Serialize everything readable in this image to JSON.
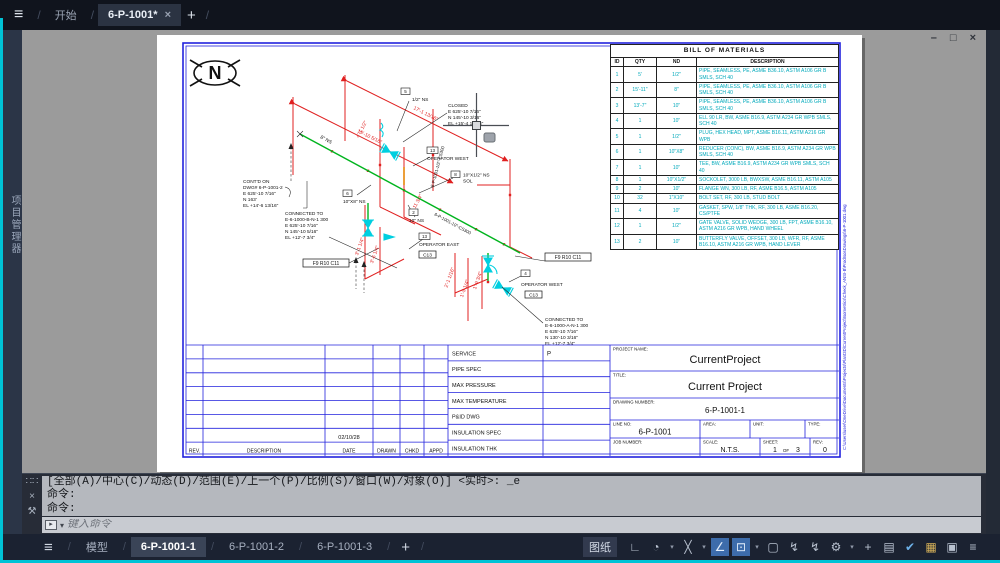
{
  "window": {
    "menu_icon": "≡",
    "slash": "/",
    "tabs": [
      {
        "label": "开始"
      },
      {
        "label": "6-P-1001*",
        "close": "×"
      }
    ],
    "new_tab": "+"
  },
  "sidebar": {
    "label": "项目管理器"
  },
  "canvas_controls": {
    "minimize": "–",
    "restore": "□",
    "close": "×"
  },
  "paper": {
    "north_letter": "N",
    "watermark_path": "C:\\Users\\user\\OneDrive\\Documents\\Projects\\Plant3D\\CurrentProject\\Isometrics\\Check_ANSI-B\\ProdIsosDrawings\\6-P-1001.dwg",
    "bom": {
      "title": "BILL OF MATERIALS",
      "headers": [
        "ID",
        "QTY",
        "ND",
        "DESCRIPTION"
      ],
      "rows": [
        {
          "id": "1",
          "qty": "5'",
          "nd": "1/2\"",
          "desc": "PIPE, SEAMLESS, PE, ASME B36.10, ASTM A106 GR B SMLS, SCH 40"
        },
        {
          "id": "2",
          "qty": "15'-11\"",
          "nd": "8\"",
          "desc": "PIPE, SEAMLESS, PE, ASME B36.10, ASTM A106 GR B SMLS, SCH 40"
        },
        {
          "id": "3",
          "qty": "13'-7\"",
          "nd": "10\"",
          "desc": "PIPE, SEAMLESS, PE, ASME B36.10, ASTM A106 GR B SMLS, SCH 40"
        },
        {
          "id": "4",
          "qty": "1",
          "nd": "10\"",
          "desc": "ELL 90 LR, BW, ASME B16.9, ASTM A234 GR WPB SMLS, SCH 40"
        },
        {
          "id": "5",
          "qty": "1",
          "nd": "1/2\"",
          "desc": "PLUG, HEX HEAD, MPT, ASME B16.11, ASTM A216 GR WPB"
        },
        {
          "id": "6",
          "qty": "1",
          "nd": "10\"X8\"",
          "desc": "REDUCER (CONC), BW, ASME B16.9, ASTM A234 GR WPB SMLS, SCH 40"
        },
        {
          "id": "7",
          "qty": "1",
          "nd": "10\"",
          "desc": "TEE, BW, ASME B16.9, ASTM A234 GR WPB SMLS, SCH 40"
        },
        {
          "id": "8",
          "qty": "1",
          "nd": "10\"X1/2\"",
          "desc": "SOCKOLET, 3000 LB, BWXSW, ASME B16.11, ASTM A105"
        },
        {
          "id": "9",
          "qty": "2",
          "nd": "10\"",
          "desc": "FLANGE WN, 300 LB, RF, ASME B16.5, ASTM A105"
        },
        {
          "id": "10",
          "qty": "32",
          "nd": "1\"X10\"",
          "desc": "BOLT SET, RF, 300 LB, STUD BOLT"
        },
        {
          "id": "11",
          "qty": "4",
          "nd": "10\"",
          "desc": "GASKET, SPW, 1/8\" THK, RF, 300 LB, ASME B16.20, CS/PTFE"
        },
        {
          "id": "12",
          "qty": "1",
          "nd": "1/2\"",
          "desc": "GATE VALVE, SOLID WEDGE, 300 LB, FPT, ASME B16.10, ASTM A216 GR WPB, HAND WHEEL"
        },
        {
          "id": "13",
          "qty": "2",
          "nd": "10\"",
          "desc": "BUTTERFLY VALVE, OFFSET, 300 LB, WFR, RF, ASME B16.10, ASTM A216 GR WPB, HAND LEVER"
        }
      ]
    },
    "spec": {
      "rows": [
        {
          "label": "SERVICE",
          "value": "P"
        },
        {
          "label": "PIPE SPEC",
          "value": ""
        },
        {
          "label": "MAX PRESSURE",
          "value": ""
        },
        {
          "label": "MAX TEMPERATURE",
          "value": ""
        },
        {
          "label": "P&ID DWG",
          "value": ""
        },
        {
          "label": "INSULATION SPEC",
          "value": ""
        },
        {
          "label": "INSULATION THK",
          "value": ""
        }
      ]
    },
    "rev_strip": {
      "date_value": "02/10/28",
      "headers": [
        "REV.",
        "DESCRIPTION",
        "DATE",
        "DRAWN",
        "CHKD",
        "APPD"
      ]
    },
    "titleblock": {
      "project_name_label": "PROJECT NAME:",
      "project_name": "CurrentProject",
      "title_label": "TITLE:",
      "title": "Current Project",
      "drawing_number_label": "DRAWING NUMBER:",
      "drawing_number": "6-P-1001-1",
      "line_no_label": "LINE NO:",
      "line_no": "6-P-1001",
      "area_label": "AREA:",
      "unit_label": "UNIT:",
      "type_label": "TYPE:",
      "job_label": "JOB NUMBER:",
      "scale_label": "SCALE:",
      "scale": "N.T.S.",
      "sheet_label": "SHEET:",
      "sheet_num": "1",
      "sheet_of": "OF",
      "sheet_total": "3",
      "rev_label": "REV:",
      "rev": "0"
    },
    "anno": {
      "dim_17": "17'-1 13/16\"",
      "dim_15": "15'-10 5/16\"",
      "dim_4_1": "4'-1 1/2\"",
      "dim_11_34": "11 3/4\"",
      "dim_3_1": "3'-1 1/4\"",
      "dim_3_6": "3'-6 1/4\"",
      "dim_2_1": "2'-1 1/16\"",
      "dim_1_5": "1'-5 1/4\"",
      "dim_1_9": "1'-9 3/4\"",
      "ns8": "8\" NS",
      "ns_half": "1/2\" NS",
      "ns_sockolet": "10\"X1/2\" NS",
      "sol": "SOL",
      "ns_reducer": "10\"X8\" NS",
      "ns10": "10\" NS",
      "tag2": "2",
      "tag4": "4",
      "tag5": "5",
      "tag6": "6",
      "tag8": "8",
      "tag13": "13",
      "op_west": "OPERATOR WEST",
      "op_east": "OPERATOR EAST",
      "grid_ref": "F9 R10 C11",
      "c13": "C13",
      "line10": "6-P-1001-10\"-CS300",
      "line_half": "6-P-1001-1/2\"-CS300",
      "closed": [
        "CLOSED",
        "E 625'-10 7/16\"",
        "N 145'-10 3/16\"",
        "EL +15'-4 13/16\""
      ],
      "contd": [
        "CONT'D ON",
        "DWG# 6-P-1001-2",
        "E 625'-10 7/16\"",
        "N 163'",
        "EL +14'-6 13/16\""
      ],
      "conn_b": [
        "CONNECTED TO",
        "E-6-1000-B-N-1 300",
        "E 625'-10 7/16\"",
        "N 145'-10 5/16\"",
        "EL +12'-7 3/4\""
      ],
      "conn_a": [
        "CONNECTED TO",
        "E-6-1000-A-N-1 300",
        "E 625'-10 7/16\"",
        "N 130'-10 3/16\"",
        "EL +12'-7 3/4\""
      ]
    }
  },
  "command": {
    "grip_icon": "∷∷",
    "close_icon": "×",
    "wrench_icon": "⚒",
    "caret": "▾",
    "history": [
      "[全部(A)/中心(C)/动态(D)/范围(E)/上一个(P)/比例(S)/窗口(W)/对象(O)] <实时>: _e",
      "命令:",
      "命令:"
    ],
    "placeholder": "键入命令"
  },
  "bottombar": {
    "menu_icon": "≡",
    "slash": "/",
    "model_tab": "模型",
    "layout_tabs": [
      "6-P-1001-1",
      "6-P-1001-2",
      "6-P-1001-3"
    ],
    "add_layout": "+",
    "paper_button": "图纸",
    "icons": {
      "ortho": "∟",
      "polar": "◔",
      "snap": "╳",
      "iso": "∠",
      "dyn": "⊡",
      "cycle": "▢",
      "anno1": "↯",
      "anno2": "↯",
      "gear": "⚙",
      "crosshair": "+",
      "units": "▤",
      "perf": "✔",
      "switch": "▦",
      "fullscreen": "▣",
      "menu": "≡",
      "caret": "▾"
    }
  }
}
